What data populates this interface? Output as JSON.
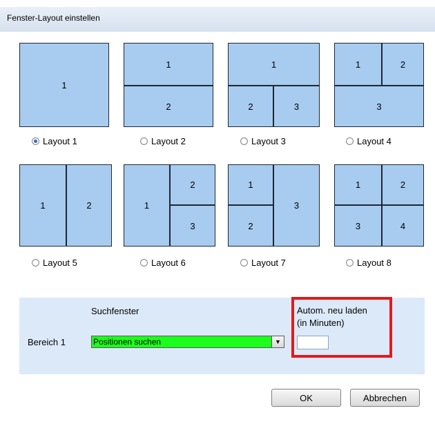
{
  "window": {
    "title": "Fenster-Layout einstellen"
  },
  "layouts": [
    {
      "label": "Layout 1",
      "selected": true,
      "panes": [
        "1"
      ]
    },
    {
      "label": "Layout 2",
      "selected": false,
      "panes": [
        "1",
        "2"
      ]
    },
    {
      "label": "Layout 3",
      "selected": false,
      "panes": [
        "1",
        "2",
        "3"
      ]
    },
    {
      "label": "Layout 4",
      "selected": false,
      "panes": [
        "1",
        "2",
        "3"
      ]
    },
    {
      "label": "Layout 5",
      "selected": false,
      "panes": [
        "1",
        "2"
      ]
    },
    {
      "label": "Layout 6",
      "selected": false,
      "panes": [
        "1",
        "2",
        "3"
      ]
    },
    {
      "label": "Layout 7",
      "selected": false,
      "panes": [
        "1",
        "2",
        "3"
      ]
    },
    {
      "label": "Layout 8",
      "selected": false,
      "panes": [
        "1",
        "2",
        "3",
        "4"
      ]
    }
  ],
  "settings": {
    "column_header": "Suchfenster",
    "auto_reload_label_1": "Autom. neu laden",
    "auto_reload_label_2": "(in Minuten)",
    "area_label": "Bereich 1",
    "area_select_value": "Positionen suchen",
    "auto_reload_value": ""
  },
  "buttons": {
    "ok": "OK",
    "cancel": "Abbrechen"
  },
  "colors": {
    "pane_fill": "#a8cbf0",
    "select_fill": "#1cff1c",
    "highlight": "#dd1c1c",
    "panel_bg": "#dce9f9"
  }
}
